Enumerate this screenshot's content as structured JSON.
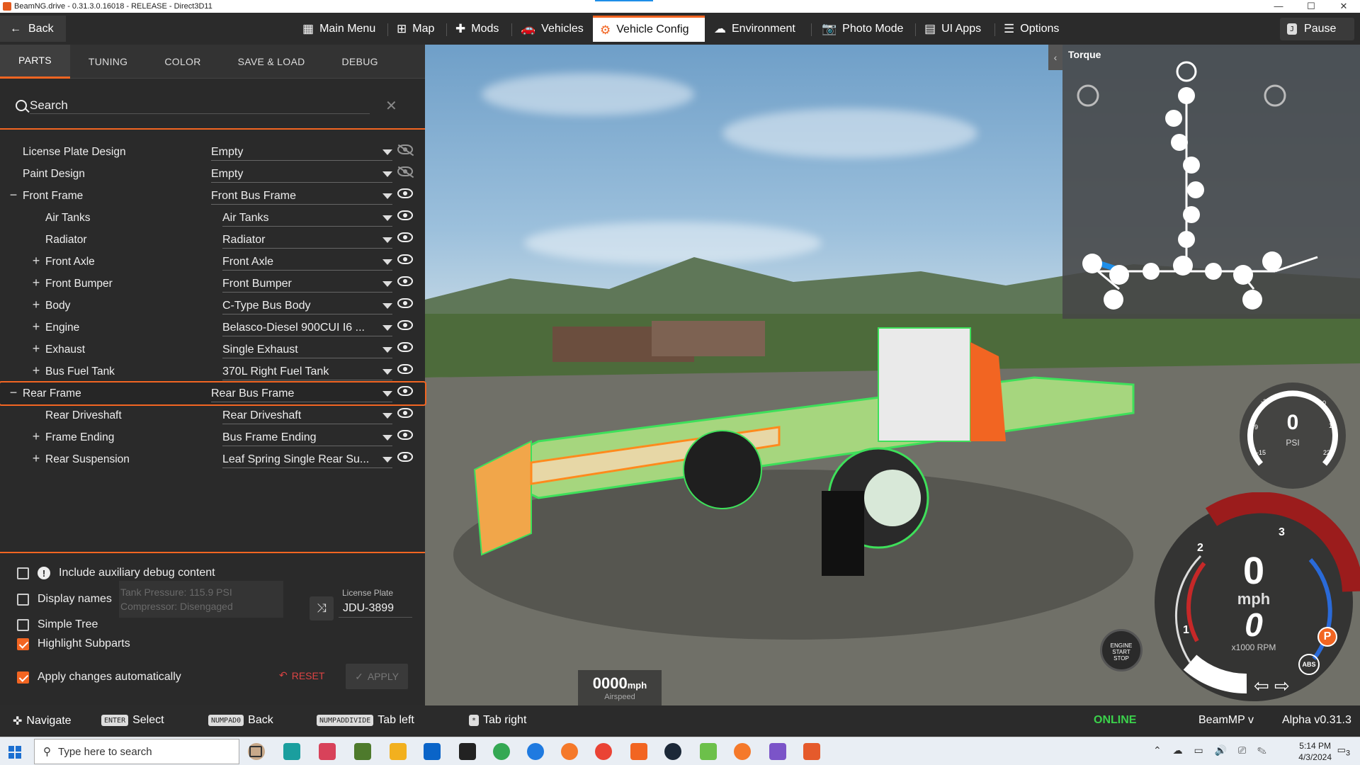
{
  "window": {
    "title": "BeamNG.drive - 0.31.3.0.16018 - RELEASE - Direct3D11"
  },
  "topnav": {
    "back": "Back",
    "items": [
      {
        "label": "Main Menu",
        "icon": "grid-icon"
      },
      {
        "label": "Map",
        "icon": "map-icon"
      },
      {
        "label": "Mods",
        "icon": "puzzle-icon"
      },
      {
        "label": "Vehicles",
        "icon": "car-icon"
      },
      {
        "label": "Vehicle Config",
        "icon": "engine-icon"
      },
      {
        "label": "Environment",
        "icon": "weather-icon"
      },
      {
        "label": "Photo Mode",
        "icon": "camera-icon"
      },
      {
        "label": "UI Apps",
        "icon": "apps-icon"
      },
      {
        "label": "Options",
        "icon": "sliders-icon"
      }
    ],
    "pause_key": "J",
    "pause": "Pause"
  },
  "panel": {
    "tabs": [
      "PARTS",
      "TUNING",
      "COLOR",
      "SAVE & LOAD",
      "DEBUG"
    ],
    "search_placeholder": "Search",
    "tree": [
      {
        "name": "License Plate Design",
        "value": "Empty",
        "toggle": "",
        "hidden": true
      },
      {
        "name": "Paint Design",
        "value": "Empty",
        "toggle": "",
        "hidden": true
      },
      {
        "name": "Front Frame",
        "value": "Front Bus Frame",
        "toggle": "−",
        "hidden": false
      },
      {
        "name": "Air Tanks",
        "value": "Air Tanks",
        "toggle": "",
        "hidden": false
      },
      {
        "name": "Radiator",
        "value": "Radiator",
        "toggle": "",
        "hidden": false
      },
      {
        "name": "Front Axle",
        "value": "Front Axle",
        "toggle": "+",
        "hidden": false
      },
      {
        "name": "Front Bumper",
        "value": "Front Bumper",
        "toggle": "+",
        "hidden": false
      },
      {
        "name": "Body",
        "value": "C-Type Bus Body",
        "toggle": "+",
        "hidden": false
      },
      {
        "name": "Engine",
        "value": "Belasco-Diesel 900CUI I6 ...",
        "toggle": "+",
        "hidden": false
      },
      {
        "name": "Exhaust",
        "value": "Single Exhaust",
        "toggle": "+",
        "hidden": false
      },
      {
        "name": "Bus Fuel Tank",
        "value": "370L Right Fuel Tank",
        "toggle": "+",
        "hidden": false
      },
      {
        "name": "Rear Frame",
        "value": "Rear Bus Frame",
        "toggle": "−",
        "hidden": false,
        "highlighted": true
      },
      {
        "name": "Rear Driveshaft",
        "value": "Rear Driveshaft",
        "toggle": "",
        "hidden": false
      },
      {
        "name": "Frame Ending",
        "value": "Bus Frame Ending",
        "toggle": "+",
        "hidden": false
      },
      {
        "name": "Rear Suspension",
        "value": "Leaf Spring Single Rear Su...",
        "toggle": "+",
        "hidden": false
      }
    ],
    "options": {
      "aux_debug": {
        "label": "Include auxiliary debug content",
        "checked": false
      },
      "display_names": {
        "label": "Display names",
        "checked": false
      },
      "simple_tree": {
        "label": "Simple Tree",
        "checked": false
      },
      "highlight_subparts": {
        "label": "Highlight Subparts",
        "checked": true
      },
      "apply_auto": {
        "label": "Apply changes automatically",
        "checked": true
      }
    },
    "ghost_text": [
      "Tank Pressure: 115.9 PSI",
      "Compressor: Disengaged"
    ],
    "license_plate": {
      "label": "License Plate",
      "value": "JDU-3899"
    },
    "reset": "RESET",
    "apply": "APPLY"
  },
  "minimap": {
    "title": "Torque"
  },
  "hud": {
    "airspeed": {
      "value": "0000",
      "unit": "mph",
      "label": "Airspeed"
    },
    "psi": {
      "value": "0",
      "unit": "PSI",
      "ticks": [
        "-3",
        "4",
        "10",
        "-9",
        "16",
        "-15",
        "22"
      ]
    },
    "speed": {
      "value": "0",
      "unit": "mph",
      "rpm": "0",
      "rpm_label": "x1000 RPM",
      "ticks": [
        "1",
        "2",
        "3"
      ]
    },
    "engine_btn": [
      "ENGINE",
      "START",
      "STOP"
    ],
    "abs": "ABS",
    "park": "P"
  },
  "bottombar": {
    "hints": [
      {
        "key": "",
        "label": "Navigate"
      },
      {
        "key": "ENTER",
        "label": "Select"
      },
      {
        "key": "NUMPAD0",
        "label": "Back"
      },
      {
        "key": "NUMPADDIVIDE",
        "label": "Tab left"
      },
      {
        "key": "*",
        "label": "Tab right"
      }
    ],
    "status": "ONLINE",
    "mp": "BeamMP v",
    "version": "Alpha v0.31.3"
  },
  "taskbar": {
    "search_placeholder": "Type here to search",
    "time": "5:14 PM",
    "date": "4/3/2024",
    "notifications": "3"
  },
  "colors": {
    "accent": "#f26522",
    "online": "#3bd24b",
    "panel": "#2a2a2a"
  }
}
